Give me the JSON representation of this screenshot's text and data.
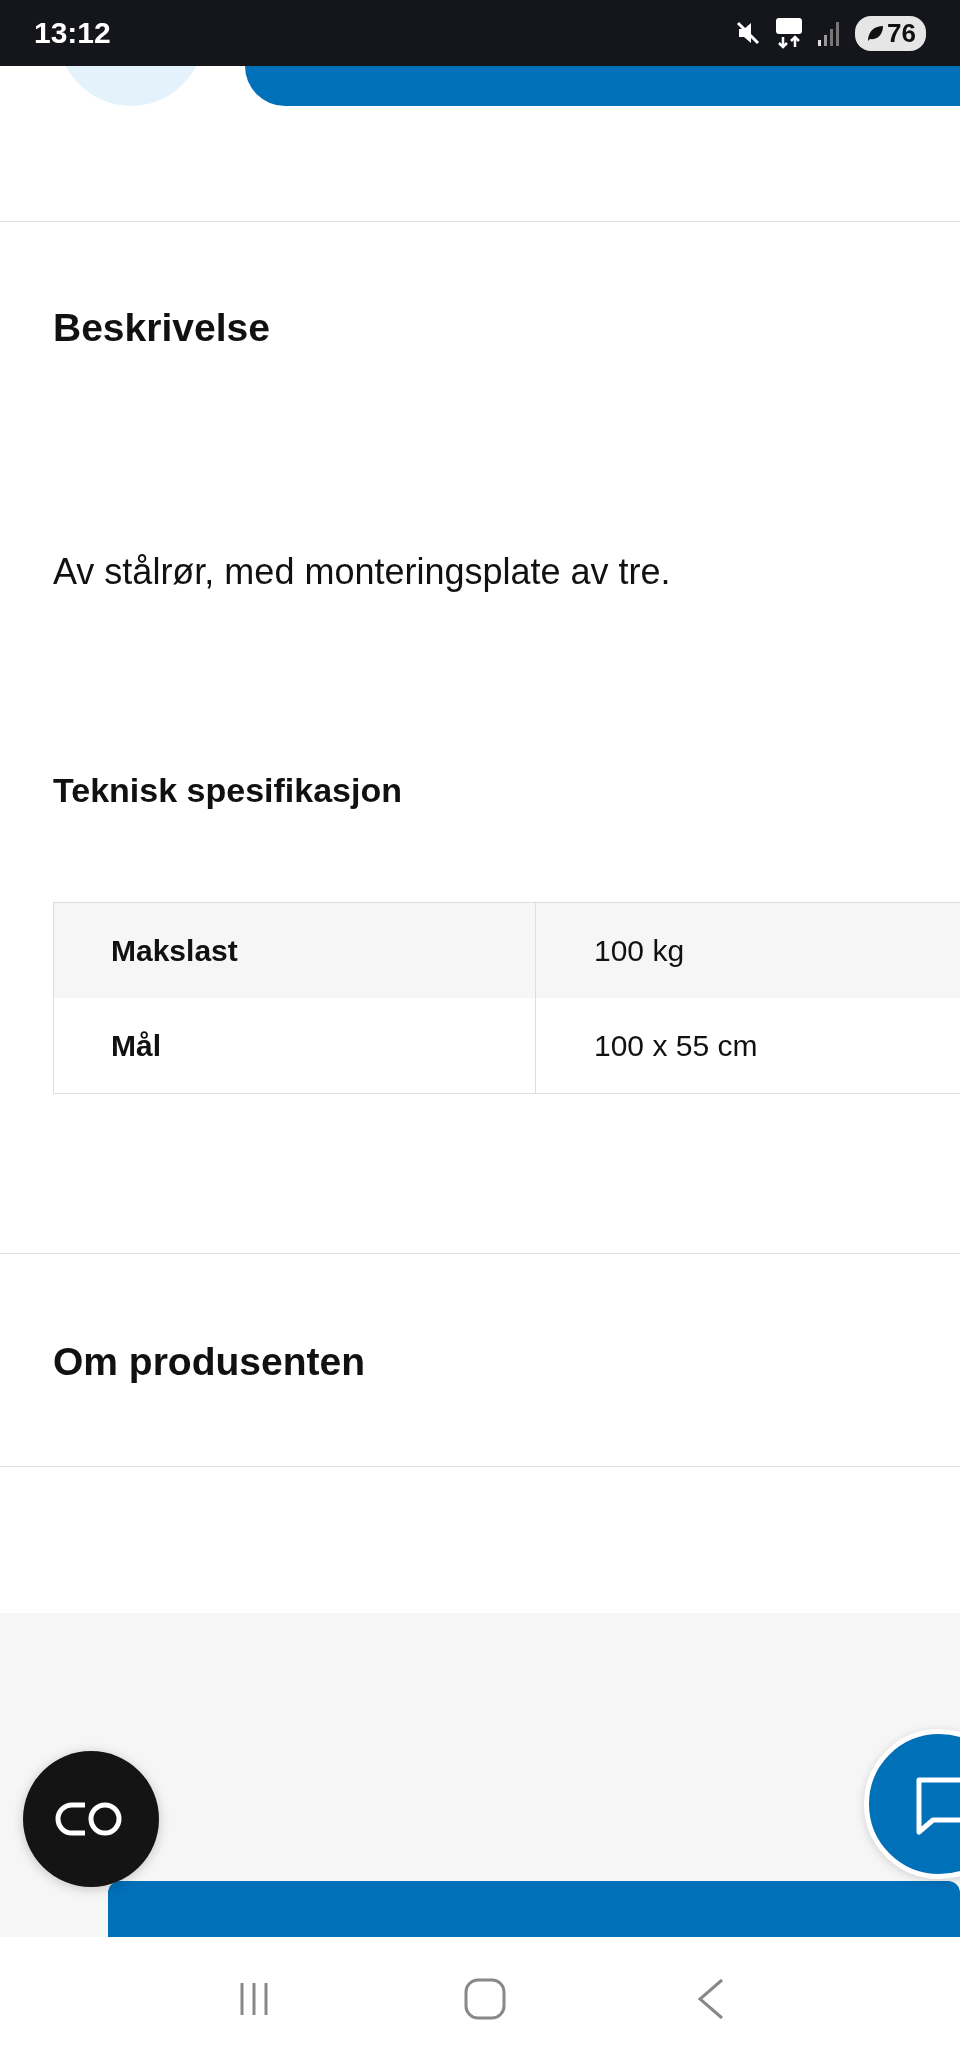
{
  "status_bar": {
    "time": "13:12",
    "battery": "76"
  },
  "description": {
    "title": "Beskrivelse",
    "text": "Av stålrør, med monteringsplate av tre."
  },
  "specifications": {
    "title": "Teknisk spesifikasjon",
    "rows": [
      {
        "label": "Makslast",
        "value": "100 kg"
      },
      {
        "label": "Mål",
        "value": "100 x 55 cm"
      }
    ]
  },
  "manufacturer": {
    "title": "Om produsenten"
  }
}
